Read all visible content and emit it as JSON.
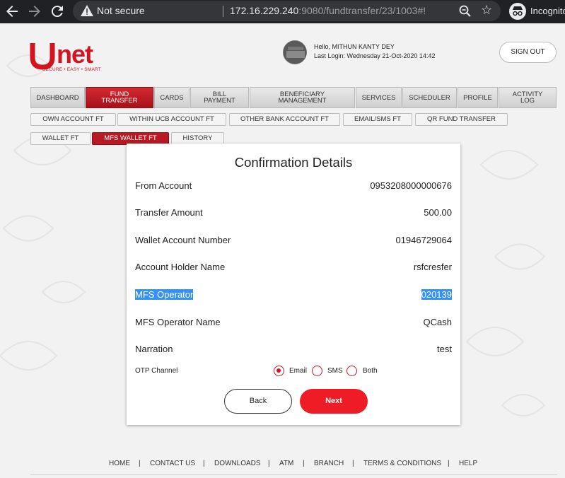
{
  "browser": {
    "security_label": "Not secure",
    "url_host": "172.16.229.240",
    "url_path": ":9080/fundtransfer/23/1003#!",
    "profile_label": "Incognito"
  },
  "header": {
    "logo_text": "unet",
    "logo_tagline": "SECURE • EASY • SMART",
    "greeting": "Hello, MITHUN KANTY DEY",
    "last_login": "Last Login: Wednesday 21-Oct-2020 14:42",
    "signout_label": "SIGN OUT"
  },
  "menu": {
    "items": [
      {
        "label": "DASHBOARD"
      },
      {
        "label": "FUND TRANSFER"
      },
      {
        "label": "CARDS"
      },
      {
        "label": "BILL PAYMENT"
      },
      {
        "label": "BENEFICIARY MANAGEMENT"
      },
      {
        "label": "SERVICES"
      },
      {
        "label": "SCHEDULER"
      },
      {
        "label": "PROFILE"
      },
      {
        "label": "ACTIVITY LOG"
      }
    ]
  },
  "submenu": {
    "items": [
      {
        "label": "OWN ACCOUNT FT"
      },
      {
        "label": "WITHIN UCB ACCOUNT FT"
      },
      {
        "label": "OTHER BANK ACCOUNT FT"
      },
      {
        "label": "EMAIL/SMS FT"
      },
      {
        "label": "QR FUND TRANSFER"
      },
      {
        "label": "WALLET FT"
      },
      {
        "label": "MFS WALLET FT"
      },
      {
        "label": "HISTORY"
      }
    ]
  },
  "confirmation": {
    "title": "Confirmation Details",
    "rows": [
      {
        "label": "From Account",
        "value": "0953208000000676"
      },
      {
        "label": "Transfer Amount",
        "value": "500.00"
      },
      {
        "label": "Wallet Account Number",
        "value": "01946729064"
      },
      {
        "label": "Account Holder Name",
        "value": "rsfcresfer"
      },
      {
        "label": "MFS Operator",
        "value": "020139"
      },
      {
        "label": "MFS Operator Name",
        "value": "QCash"
      },
      {
        "label": "Narration",
        "value": "test"
      }
    ],
    "otp_label": "OTP Channel",
    "otp_options": [
      {
        "label": "Email",
        "selected": true
      },
      {
        "label": "SMS",
        "selected": false
      },
      {
        "label": "Both",
        "selected": false
      }
    ],
    "back_label": "Back",
    "next_label": "Next"
  },
  "footer": {
    "links": [
      {
        "label": "HOME"
      },
      {
        "label": "CONTACT US"
      },
      {
        "label": "DOWNLOADS"
      },
      {
        "label": "ATM"
      },
      {
        "label": "BRANCH"
      },
      {
        "label": "TERMS & CONDITIONS"
      },
      {
        "label": "HELP"
      }
    ],
    "separator": "|"
  },
  "colors": {
    "brand_red": "#d3131f",
    "next_button": "#ee1c25",
    "selection_highlight": "#3390ff"
  }
}
